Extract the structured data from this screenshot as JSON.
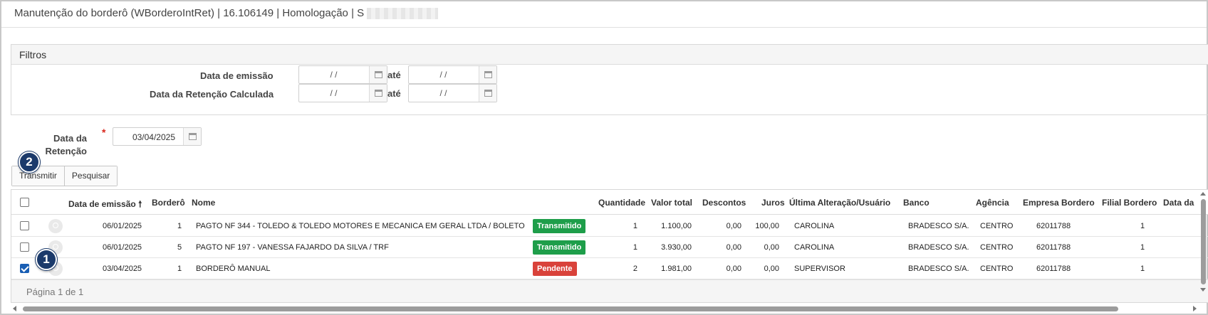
{
  "window": {
    "title": "Manutenção do borderô (WBorderoIntRet) | 16.106149 | Homologação | S"
  },
  "filters": {
    "header": "Filtros",
    "emissao_label": "Data de emissão",
    "retencao_calc_label": "Data da Retenção Calculada",
    "ate_label": "até",
    "emissao_from": " /  /",
    "emissao_to": " /  /",
    "calc_from": " /  /",
    "calc_to": " /  /",
    "calendar_icon": "calendar-icon"
  },
  "retencao": {
    "label_line1": "Data da",
    "label_line2": "Retenção",
    "required_mark": "*",
    "value": "03/04/2025"
  },
  "toolbar": {
    "transmitir_label": "Transmitir",
    "pesquisar_label": "Pesquisar"
  },
  "markers": [
    "1",
    "2"
  ],
  "grid": {
    "columns": [
      "Data de emissão",
      "Borderô",
      "Nome",
      "Quantidade",
      "Valor total",
      "Descontos",
      "Juros",
      "Última Alteração/Usuário",
      "Banco",
      "Agência",
      "Empresa Bordero",
      "Filial Bordero",
      "Data da"
    ],
    "sort_indicator": "🠕",
    "rows": [
      {
        "checked": false,
        "data": "06/01/2025",
        "bordero": "1",
        "nome": "PAGTO NF 344 - TOLEDO & TOLEDO MOTORES E MECANICA EM GERAL LTDA / BOLETO",
        "status": "Transmitido",
        "quantidade": "1",
        "valor": "1.100,00",
        "descontos": "0,00",
        "juros": "100,00",
        "usuario": "CAROLINA",
        "banco": "BRADESCO S/A.",
        "agencia": "CENTRO",
        "empresa": "62011788",
        "filial": "1"
      },
      {
        "checked": false,
        "data": "06/01/2025",
        "bordero": "5",
        "nome": "PAGTO NF 197 - VANESSA FAJARDO DA SILVA / TRF",
        "status": "Transmitido",
        "quantidade": "1",
        "valor": "3.930,00",
        "descontos": "0,00",
        "juros": "0,00",
        "usuario": "CAROLINA",
        "banco": "BRADESCO S/A.",
        "agencia": "CENTRO",
        "empresa": "62011788",
        "filial": "1"
      },
      {
        "checked": true,
        "data": "03/04/2025",
        "bordero": "1",
        "nome": "BORDERÔ MANUAL",
        "status": "Pendente",
        "quantidade": "2",
        "valor": "1.981,00",
        "descontos": "0,00",
        "juros": "0,00",
        "usuario": "SUPERVISOR",
        "banco": "BRADESCO S/A.",
        "agencia": "CENTRO",
        "empresa": "62011788",
        "filial": "1"
      }
    ],
    "pager": "Página 1 de 1"
  },
  "colors": {
    "transmitido": "#1e9e4a",
    "pendente": "#d9423a",
    "marker": "#1b3a6b"
  }
}
